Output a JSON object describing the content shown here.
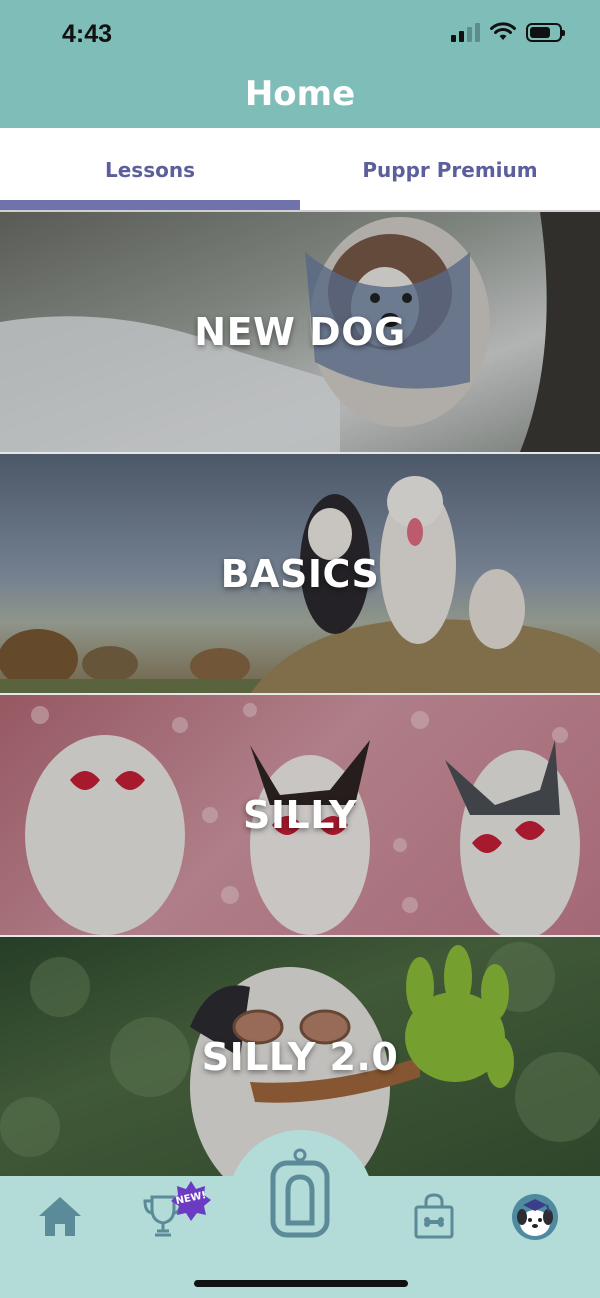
{
  "status_bar": {
    "time": "4:43"
  },
  "header": {
    "title": "Home",
    "background_color": "#7fbdb8"
  },
  "tabs": [
    {
      "label": "Lessons",
      "active": true
    },
    {
      "label": "Puppr Premium",
      "active": false
    }
  ],
  "lessons": [
    {
      "title": "NEW DOG"
    },
    {
      "title": "BASICS"
    },
    {
      "title": "SILLY"
    },
    {
      "title": "SILLY 2.0"
    }
  ],
  "bottom_nav": {
    "items": [
      {
        "icon": "home-icon"
      },
      {
        "icon": "trophy-icon",
        "badge": "NEW!"
      },
      {
        "icon": "clicker-icon"
      },
      {
        "icon": "shop-bag-icon"
      },
      {
        "icon": "profile-dog-avatar-icon"
      }
    ],
    "background_color": "#b3dbd8",
    "icon_color": "#5b8a99"
  }
}
